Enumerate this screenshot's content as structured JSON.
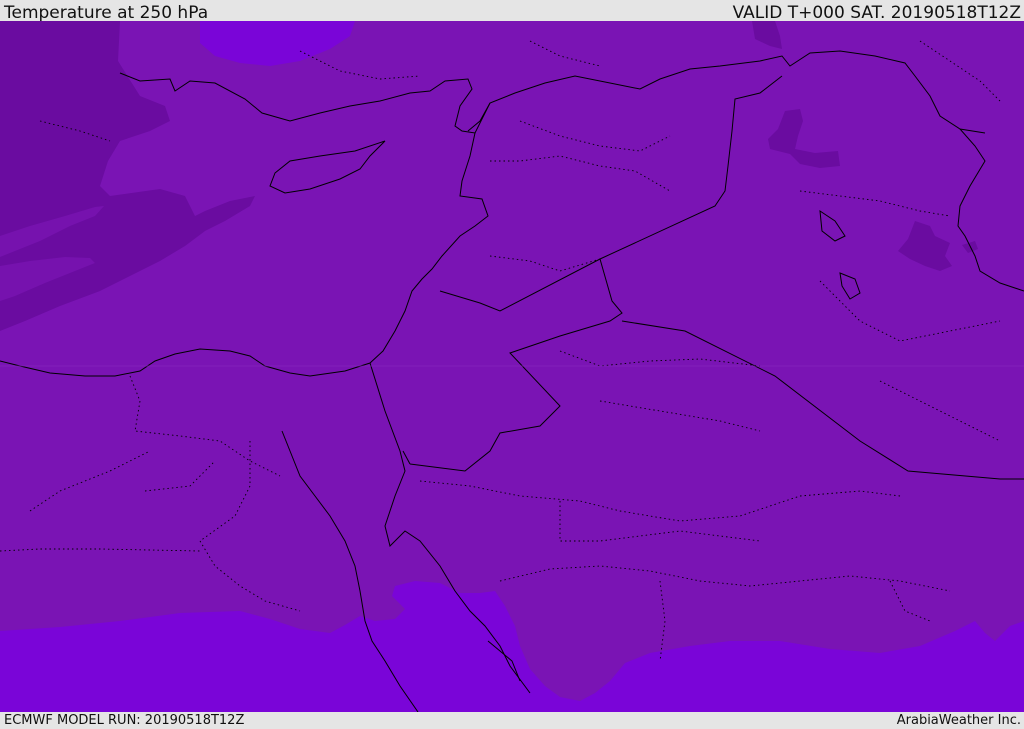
{
  "header": {
    "title": "Temperature at 250 hPa",
    "valid_time": "VALID T+000 SAT. 20190518T12Z"
  },
  "footer": {
    "model_run": "ECMWF MODEL RUN: 20190518T12Z",
    "credit": "ArabiaWeather Inc."
  },
  "colors": {
    "background": "#e5e5e5",
    "temp_base": "#7a14b4",
    "temp_warm": "#7a05d8",
    "temp_cold": "#6a0ca0",
    "temp_cold_mid": "#7612ae",
    "border_line": "#000000"
  }
}
